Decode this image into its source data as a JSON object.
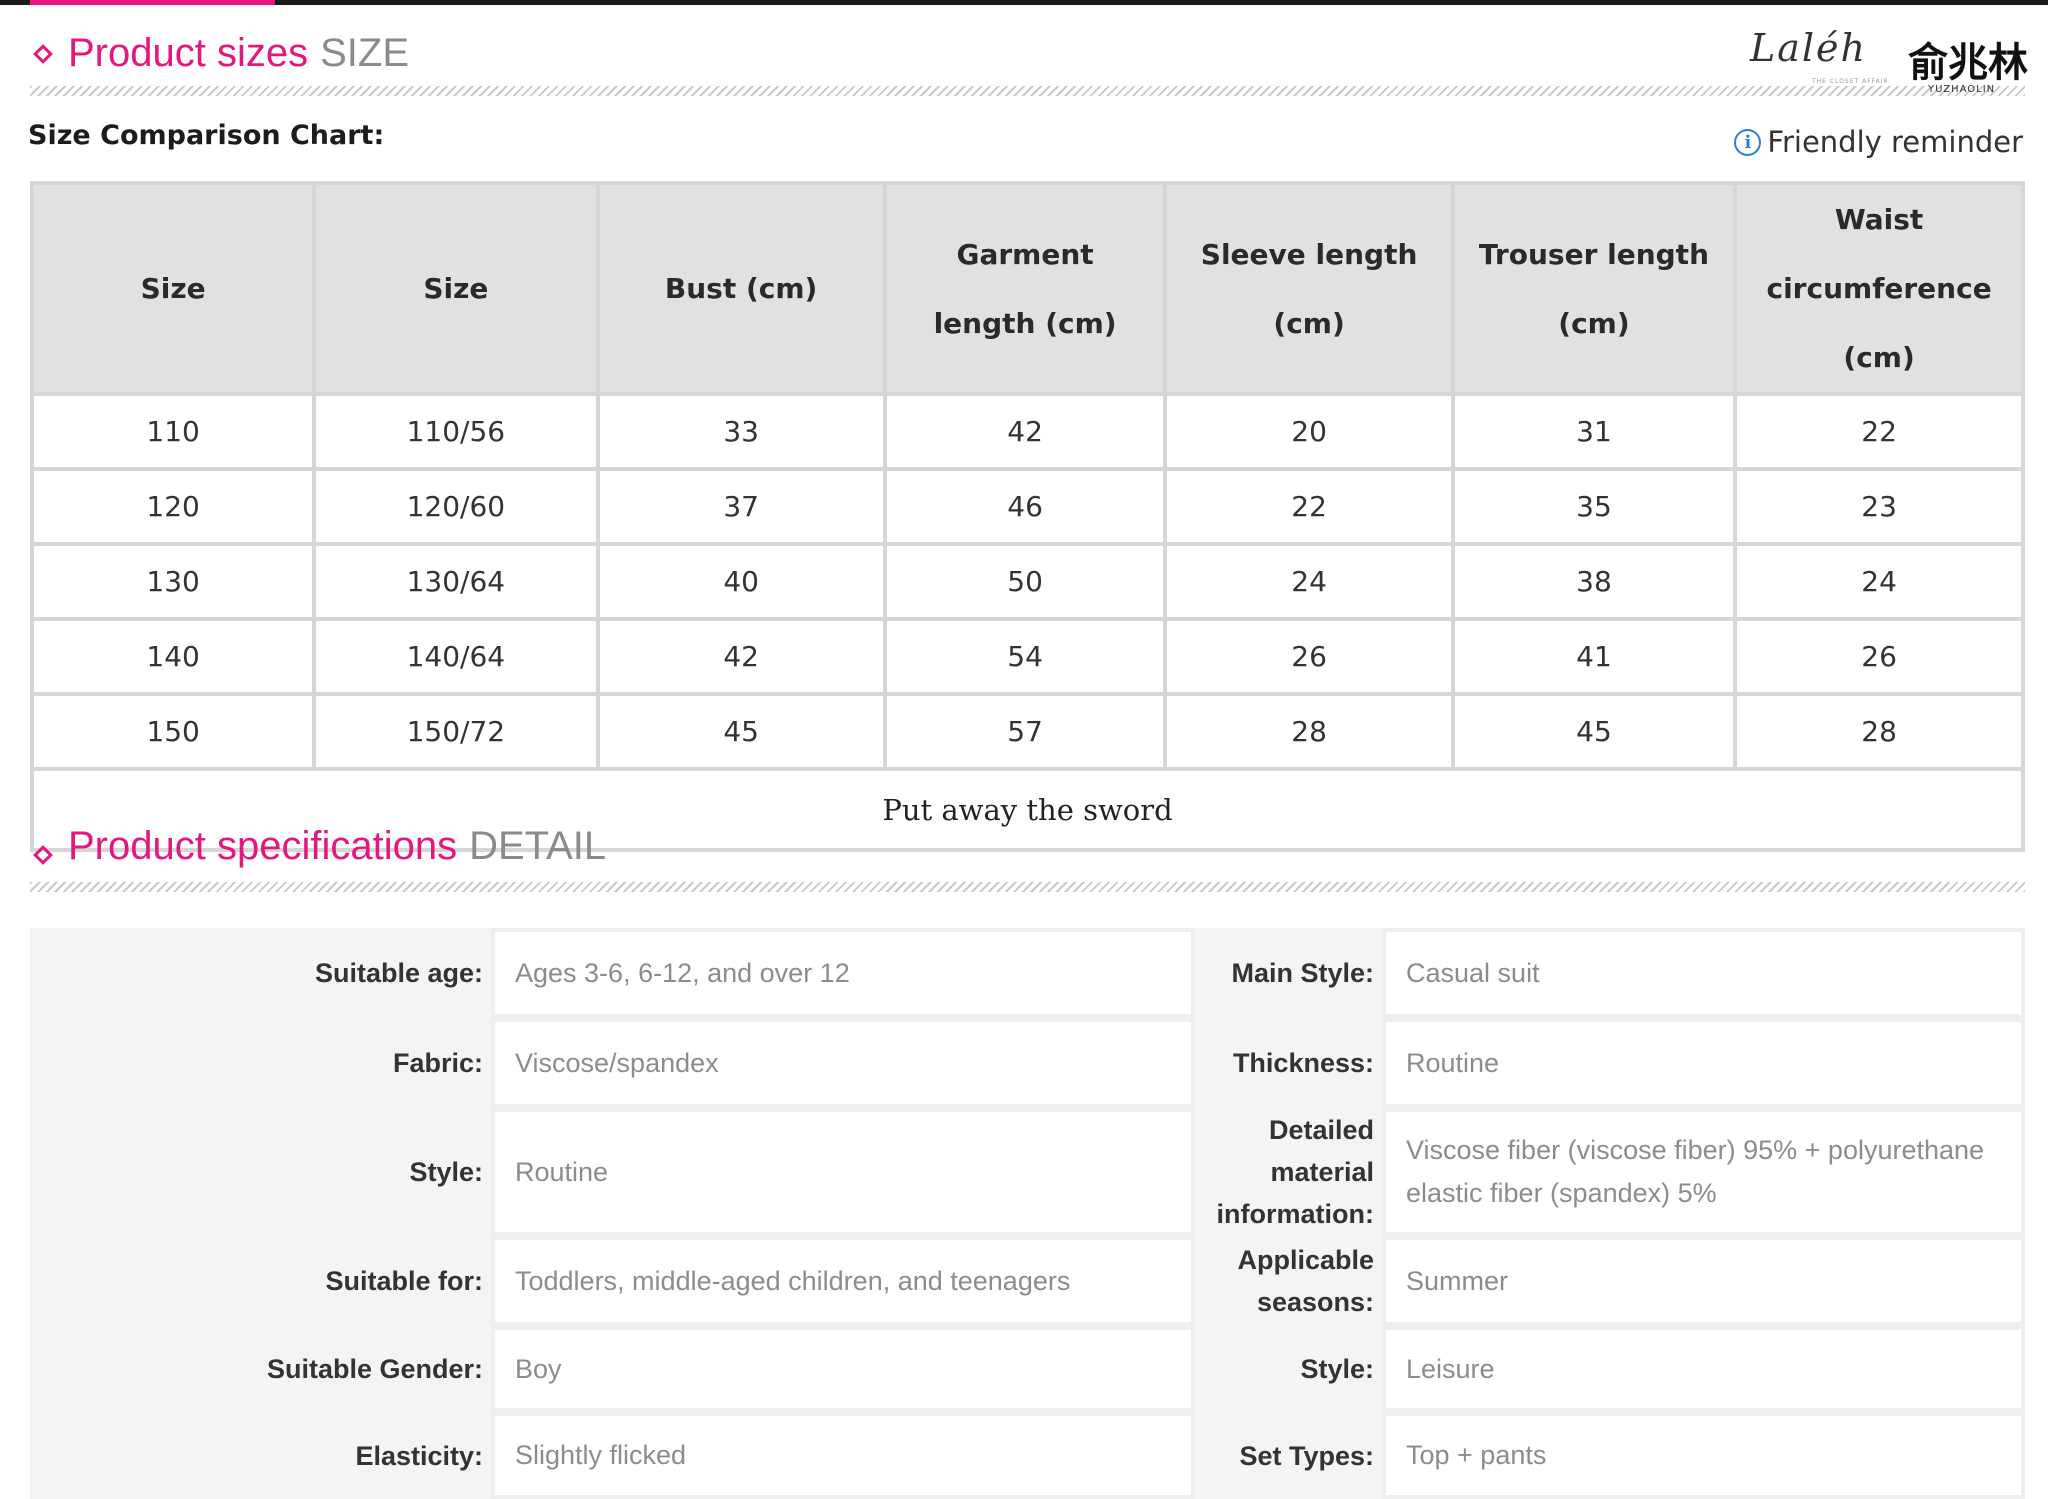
{
  "sizes_section": {
    "title": "Product sizes",
    "title_en": "SIZE",
    "chart_label": "Size Comparison Chart:",
    "reminder": "Friendly reminder"
  },
  "brand": {
    "script": "Laléh",
    "script_sub": "THE CLOSET AFFAIR",
    "cn": "俞兆林",
    "cn_sub": "YUZHAOLIN"
  },
  "size_table": {
    "headers": [
      "Size",
      "Size",
      "Bust (cm)",
      "Garment length (cm)",
      "Sleeve length (cm)",
      "Trouser length (cm)",
      "Waist circumference (cm)"
    ],
    "rows": [
      [
        "110",
        "110/56",
        "33",
        "42",
        "20",
        "31",
        "22"
      ],
      [
        "120",
        "120/60",
        "37",
        "46",
        "22",
        "35",
        "23"
      ],
      [
        "130",
        "130/64",
        "40",
        "50",
        "24",
        "38",
        "24"
      ],
      [
        "140",
        "140/64",
        "42",
        "54",
        "26",
        "41",
        "26"
      ],
      [
        "150",
        "150/72",
        "45",
        "57",
        "28",
        "45",
        "28"
      ]
    ],
    "footer": "Put away the sword"
  },
  "specs_section": {
    "title": "Product specifications",
    "title_en": "DETAIL"
  },
  "specs": [
    {
      "label1": "Suitable age:",
      "value1": "Ages 3-6, 6-12, and over 12",
      "label2": "Main Style:",
      "value2": "Casual suit"
    },
    {
      "label1": "Fabric:",
      "value1": "Viscose/spandex",
      "label2": "Thickness:",
      "value2": "Routine"
    },
    {
      "label1": "Style:",
      "value1": "Routine",
      "label2": "Detailed material information:",
      "value2": "Viscose fiber (viscose fiber) 95% + polyurethane elastic fiber (spandex) 5%"
    },
    {
      "label1": "Suitable for:",
      "value1": "Toddlers, middle-aged children, and teenagers",
      "label2": "Applicable seasons:",
      "value2": "Summer"
    },
    {
      "label1": "Suitable Gender:",
      "value1": "Boy",
      "label2": "Style:",
      "value2": "Leisure"
    },
    {
      "label1": "Elasticity:",
      "value1": "Slightly flicked",
      "label2": "Set Types:",
      "value2": "Top + pants"
    }
  ],
  "colors": {
    "accent": "#e5167e",
    "header_bg": "#e1e1e1",
    "label_bg": "#f4f4f4"
  }
}
